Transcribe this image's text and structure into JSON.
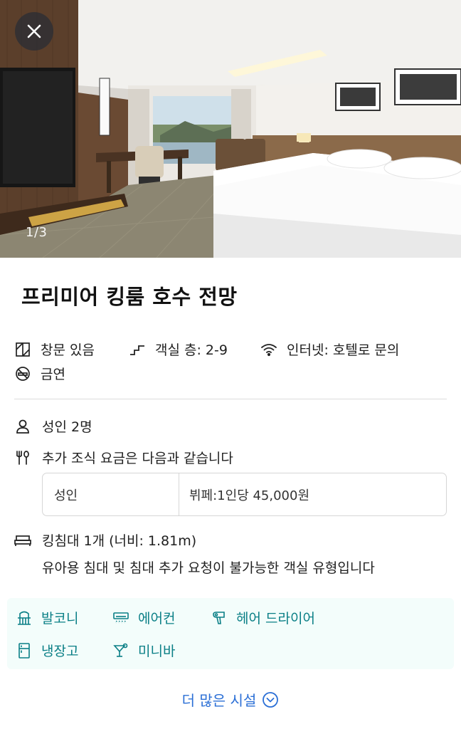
{
  "photo": {
    "counter": "1/3"
  },
  "room": {
    "title": "프리미어 킹룸 호수 전망"
  },
  "features": {
    "window": "창문 있음",
    "floor": "객실 층: 2-9",
    "internet": "인터넷: 호텔로 문의",
    "smoking": "금연"
  },
  "occupancy": {
    "adults": "성인 2명"
  },
  "breakfast": {
    "intro": "추가 조식 요금은 다음과 같습니다",
    "table": {
      "guest_type": "성인",
      "price": "뷔페:1인당 45,000원"
    }
  },
  "bed": {
    "info": "킹침대 1개 (너비: 1.81m)",
    "note": "유아용 침대 및 침대 추가 요청이 불가능한 객실 유형입니다"
  },
  "amenities": {
    "balcony": "발코니",
    "aircon": "에어컨",
    "hairdryer": "헤어 드라이어",
    "fridge": "냉장고",
    "minibar": "미니바"
  },
  "more_link": "더 많은 시설",
  "colors": {
    "accent_teal": "#0a7f86",
    "link_blue": "#2b6fd6",
    "amenity_bg": "#f3fdfb"
  },
  "icons": {
    "close": "close-icon",
    "window": "window-icon",
    "stairs": "stairs-icon",
    "wifi": "wifi-icon",
    "no_smoking": "no-smoking-icon",
    "person": "person-icon",
    "utensils": "utensils-icon",
    "bed": "bed-icon",
    "balcony": "balcony-icon",
    "aircon": "air-conditioner-icon",
    "hairdryer": "hair-dryer-icon",
    "fridge": "fridge-icon",
    "minibar": "cocktail-icon",
    "chevron": "chevron-down-circle-icon"
  }
}
